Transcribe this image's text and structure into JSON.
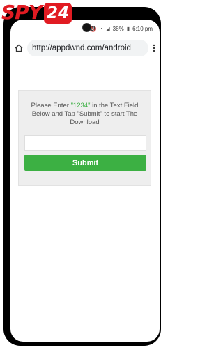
{
  "watermark": {
    "logo_prefix": "SPY",
    "logo_badge": "24"
  },
  "status_bar": {
    "battery": "38%",
    "time": "6:10 pm"
  },
  "browser": {
    "url": "http://appdwnd.com/android"
  },
  "page": {
    "instruction_before": "Please Enter ",
    "code": "\"1234\"",
    "instruction_after": " in the Text Field Below and Tap \"Submit\" to start The Download",
    "input_value": "",
    "submit_label": "Submit"
  },
  "colors": {
    "accent_green": "#3cb043",
    "logo_red": "#e11b22"
  }
}
